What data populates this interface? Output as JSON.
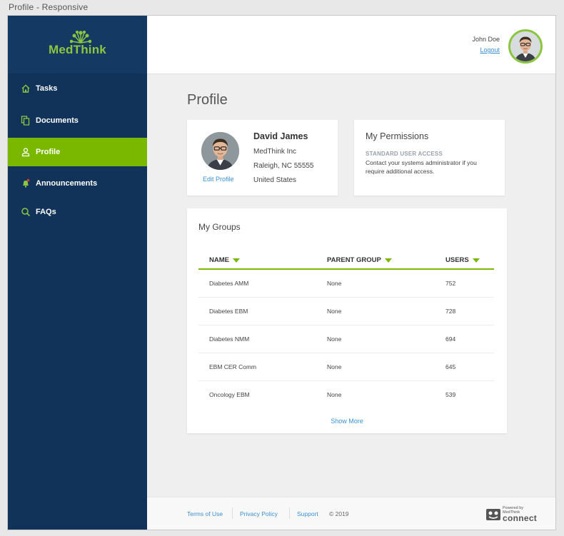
{
  "window": {
    "title": "Profile - Responsive"
  },
  "brand": {
    "logo_text": "MedThink",
    "accent": "#8cc63f",
    "sidebar_bg": "#11335a"
  },
  "sidebar": {
    "items": [
      {
        "label": "Tasks",
        "icon": "home-icon",
        "active": false
      },
      {
        "label": "Documents",
        "icon": "documents-icon",
        "active": false
      },
      {
        "label": "Profile",
        "icon": "user-icon",
        "active": true
      },
      {
        "label": "Announcements",
        "icon": "bell-icon",
        "active": false
      },
      {
        "label": "FAQs",
        "icon": "search-icon",
        "active": false
      }
    ]
  },
  "header": {
    "user_name": "John Doe",
    "logout_label": "Logout"
  },
  "page": {
    "title": "Profile"
  },
  "profile": {
    "name": "David James",
    "company": "MedThink Inc",
    "city": "Raleigh, NC 55555",
    "country": "United States",
    "edit_label": "Edit Profile"
  },
  "permissions": {
    "title": "My Permissions",
    "level": "STANDARD USER ACCESS",
    "description": "Contact your systems administrator if you require additional access."
  },
  "groups": {
    "title": "My Groups",
    "columns": [
      "NAME",
      "PARENT GROUP",
      "USERS"
    ],
    "rows": [
      {
        "name": "Diabetes AMM",
        "parent": "None",
        "users": "752"
      },
      {
        "name": "Diabetes EBM",
        "parent": "None",
        "users": "728"
      },
      {
        "name": "Diabetes NMM",
        "parent": "None",
        "users": "694"
      },
      {
        "name": "EBM CER Comm",
        "parent": "None",
        "users": "645"
      },
      {
        "name": "Oncology EBM",
        "parent": "None",
        "users": "539"
      }
    ],
    "show_more_label": "Show More"
  },
  "footer": {
    "links": [
      "Terms of Use",
      "Privacy Policy",
      "Support"
    ],
    "copyright": "© 2019",
    "powered_by": "Powered by",
    "powered_brand": "MedThink",
    "connect": "connect"
  }
}
